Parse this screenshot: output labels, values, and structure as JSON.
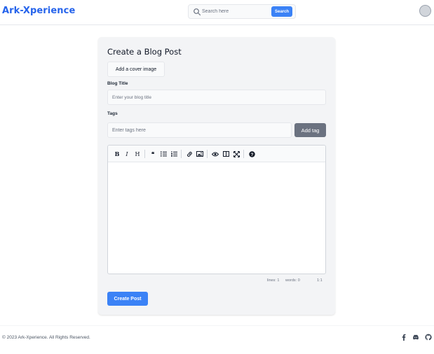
{
  "header": {
    "brand": "Ark-Xperience",
    "search": {
      "placeholder": "Search here",
      "button_label": "Search"
    }
  },
  "form": {
    "title": "Create a Blog Post",
    "cover_button_label": "Add a cover image",
    "blog_title_label": "Blog Title",
    "blog_title_placeholder": "Enter your blog title",
    "tags_label": "Tags",
    "tags_placeholder": "Enter tags here",
    "add_tag_label": "Add tag",
    "editor": {
      "toolbar": {
        "bold": "B",
        "italic": "I",
        "heading": "H",
        "quote": "❝",
        "help": "?"
      },
      "status": {
        "lines": "lines: 1",
        "words": "words: 0",
        "cursor": "1:1"
      }
    },
    "submit_label": "Create Post"
  },
  "footer": {
    "copyright": "© 2023 Ark-Xperience. All Rights Reserved.",
    "social_icons": [
      "facebook-icon",
      "discord-icon",
      "github-icon"
    ]
  },
  "colors": {
    "brand": "#2563eb",
    "primary_button": "#3b82f6",
    "secondary_button": "#6b7280",
    "card_background": "#f3f4f6"
  }
}
